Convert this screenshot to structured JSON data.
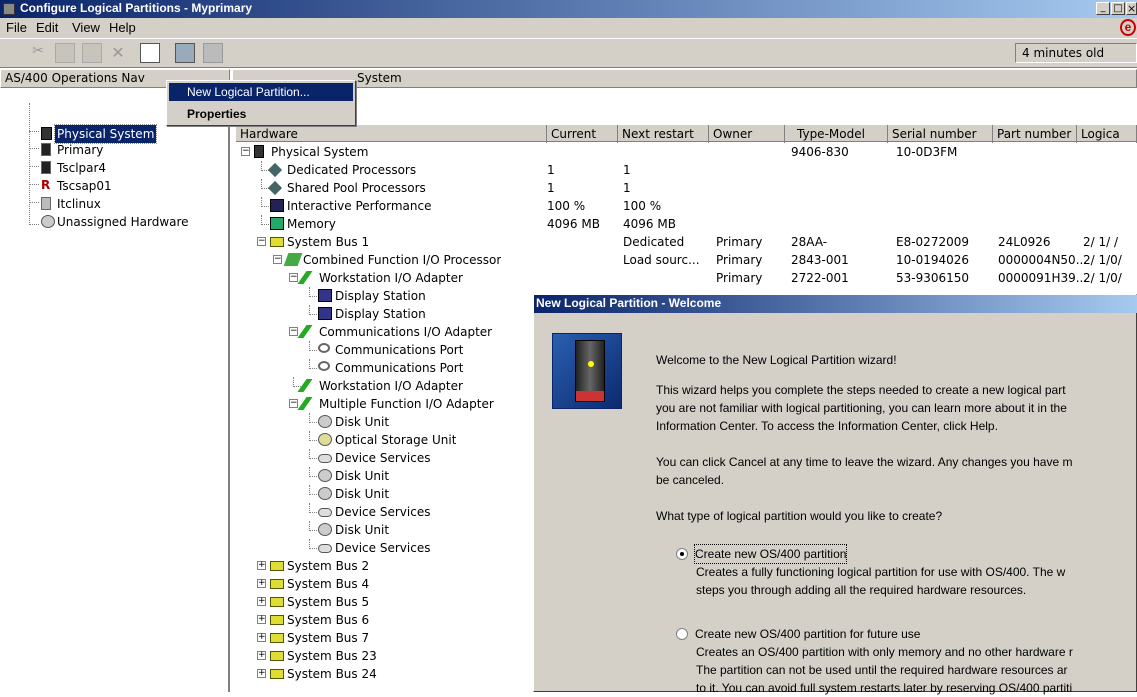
{
  "window": {
    "title": "Configure Logical Partitions - Myprimary",
    "age": "4 minutes old",
    "min": "_",
    "max": "□",
    "close": "×"
  },
  "menu": {
    "items": [
      "File",
      "Edit",
      "View",
      "Help"
    ]
  },
  "context_menu": {
    "items": [
      "New Logical Partition...",
      "Properties"
    ]
  },
  "left_panel": {
    "header": "AS/400 Operations Nav",
    "items": [
      "Physical System",
      "Primary",
      "Tsclpar4",
      "Tscsap01",
      "Itclinux",
      "Unassigned Hardware"
    ]
  },
  "right_panel": {
    "header_label": "System"
  },
  "table": {
    "columns": [
      "Hardware",
      "Current",
      "Next restart",
      "Owner",
      "Type-Model",
      "Serial number",
      "Part number",
      "Logica"
    ],
    "rows": [
      {
        "name": "Physical System",
        "current": "",
        "next": "",
        "owner": "",
        "type": "9406-830",
        "serial": "10-0D3FM",
        "part": "",
        "logical": ""
      },
      {
        "name": "Dedicated Processors",
        "current": "1",
        "next": "1",
        "owner": "",
        "type": "",
        "serial": "",
        "part": "",
        "logical": ""
      },
      {
        "name": "Shared Pool Processors",
        "current": "1",
        "next": "1",
        "owner": "",
        "type": "",
        "serial": "",
        "part": "",
        "logical": ""
      },
      {
        "name": "Interactive Performance",
        "current": "100 %",
        "next": "100 %",
        "owner": "",
        "type": "",
        "serial": "",
        "part": "",
        "logical": ""
      },
      {
        "name": "Memory",
        "current": "4096 MB",
        "next": "4096 MB",
        "owner": "",
        "type": "",
        "serial": "",
        "part": "",
        "logical": ""
      },
      {
        "name": "System Bus 1",
        "current": "",
        "next": "Dedicated",
        "owner": "Primary",
        "type": "28AA-",
        "serial": "E8-0272009",
        "part": "24L0926",
        "logical": "2/ 1/ /"
      },
      {
        "name": "Combined Function I/O Processor",
        "current": "",
        "next": "Load sourc...",
        "owner": "Primary",
        "type": "2843-001",
        "serial": "10-0194026",
        "part": "0000004N50...",
        "logical": "2/ 1/0/"
      },
      {
        "name": "Workstation I/O Adapter",
        "current": "",
        "next": "",
        "owner": "Primary",
        "type": "2722-001",
        "serial": "53-9306150",
        "part": "0000091H39...",
        "logical": "2/ 1/0/"
      },
      {
        "name": "Display Station"
      },
      {
        "name": "Display Station"
      },
      {
        "name": "Communications I/O Adapter"
      },
      {
        "name": "Communications Port"
      },
      {
        "name": "Communications Port"
      },
      {
        "name": "Workstation I/O Adapter"
      },
      {
        "name": "Multiple Function I/O Adapter"
      },
      {
        "name": "Disk Unit"
      },
      {
        "name": "Optical Storage Unit"
      },
      {
        "name": "Device Services"
      },
      {
        "name": "Disk Unit"
      },
      {
        "name": "Disk Unit"
      },
      {
        "name": "Device Services"
      },
      {
        "name": "Disk Unit"
      },
      {
        "name": "Device Services"
      },
      {
        "name": "System Bus 2"
      },
      {
        "name": "System Bus 4"
      },
      {
        "name": "System Bus 5"
      },
      {
        "name": "System Bus 6"
      },
      {
        "name": "System Bus 7"
      },
      {
        "name": "System Bus 23"
      },
      {
        "name": "System Bus 24"
      }
    ]
  },
  "dialog": {
    "title": "New Logical Partition - Welcome",
    "p1": "Welcome to the New Logical Partition wizard!",
    "p2a": "This wizard helps you complete the steps needed to create a new logical part",
    "p2b": "you are not familiar with logical partitioning, you can learn more about it in the",
    "p2c": "Information Center.  To access the Information Center, click Help.",
    "p3a": "You can click Cancel at any time to leave the wizard. Any changes you have m",
    "p3b": "be canceled.",
    "question": "What type of logical partition would you like to create?",
    "opt1": "Create new OS/400 partition",
    "opt1a": "Creates a fully functioning logical partition for use with OS/400.  The w",
    "opt1b": "steps you through adding all the required hardware resources.",
    "opt2": "Create new OS/400 partition for future use",
    "opt2a": "Creates an OS/400 partition with only memory and no other hardware r",
    "opt2b": " The partition can not be used until the required hardware resources ar",
    "opt2c": "to it. You can avoid full system restarts later by reserving OS/400 partiti"
  }
}
